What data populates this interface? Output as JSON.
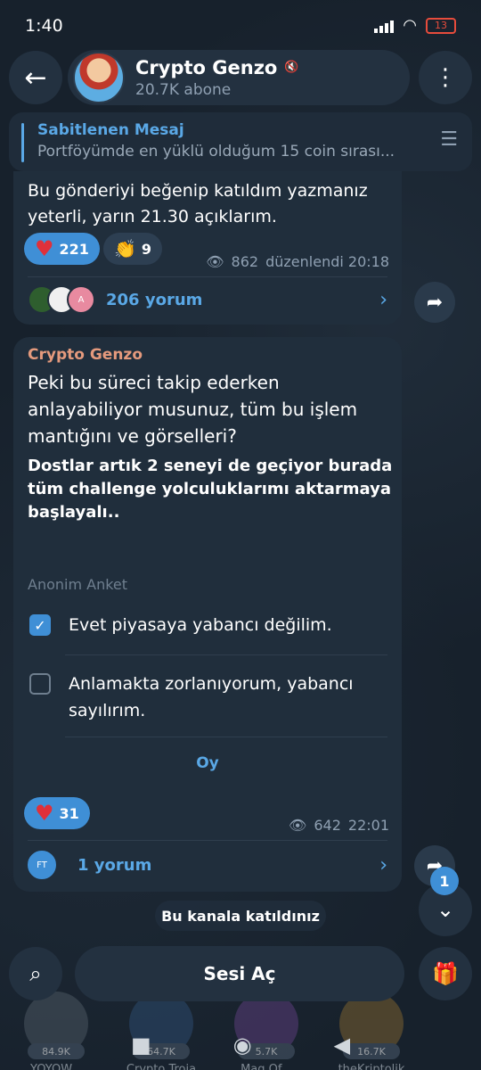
{
  "status": {
    "time": "1:40",
    "battery": "13"
  },
  "header": {
    "channel_name": "Crypto Genzo",
    "subscribers": "20.7K abone"
  },
  "pinned": {
    "title": "Sabitlenen Mesaj",
    "text": "Portföyümde en yüklü olduğum 15 coin sırası..."
  },
  "message1": {
    "text": "Bu gönderiyi beğenip katıldım yazmanız yeterli, yarın 21.30 açıklarım.",
    "reactions": [
      {
        "emoji": "heart",
        "count": "221"
      },
      {
        "emoji": "clap",
        "count": "9"
      }
    ],
    "views": "862",
    "edited_time": "düzenlendi 20:18",
    "comments": "206 yorum"
  },
  "message2": {
    "author": "Crypto Genzo",
    "question": "Peki bu süreci takip ederken anlayabiliyor musunuz, tüm bu işlem mantığını ve görselleri?",
    "bold_text": "Dostlar artık 2 seneyi de geçiyor burada tüm challenge yolculuklarımı aktarmaya başlayalı..",
    "poll_type": "Anonim Anket",
    "options": [
      {
        "label": "Evet piyasaya yabancı değilim.",
        "checked": true
      },
      {
        "label": "Anlamakta zorlanıyorum, yabancı sayılırım.",
        "checked": false
      }
    ],
    "vote_label": "Oy",
    "reaction_count": "31",
    "views": "642",
    "time": "22:01",
    "comments": "1 yorum",
    "comment_avatar": "FT"
  },
  "notice": "Bu kanala katıldınız",
  "unread_count": "1",
  "bottom": {
    "mute_label": "Sesi Aç"
  },
  "similar_channels": [
    {
      "count": "84.9K",
      "name": "YOYOW..."
    },
    {
      "count": "64.7K",
      "name": "Crypto Troia"
    },
    {
      "count": "5.7K",
      "name": "Mag Of..."
    },
    {
      "count": "16.7K",
      "name": "theKriptolik"
    }
  ],
  "colors": {
    "accent": "#5aa8e6",
    "author": "#e59a7d",
    "heart": "#e0303a",
    "bubble": "#202e3c"
  }
}
